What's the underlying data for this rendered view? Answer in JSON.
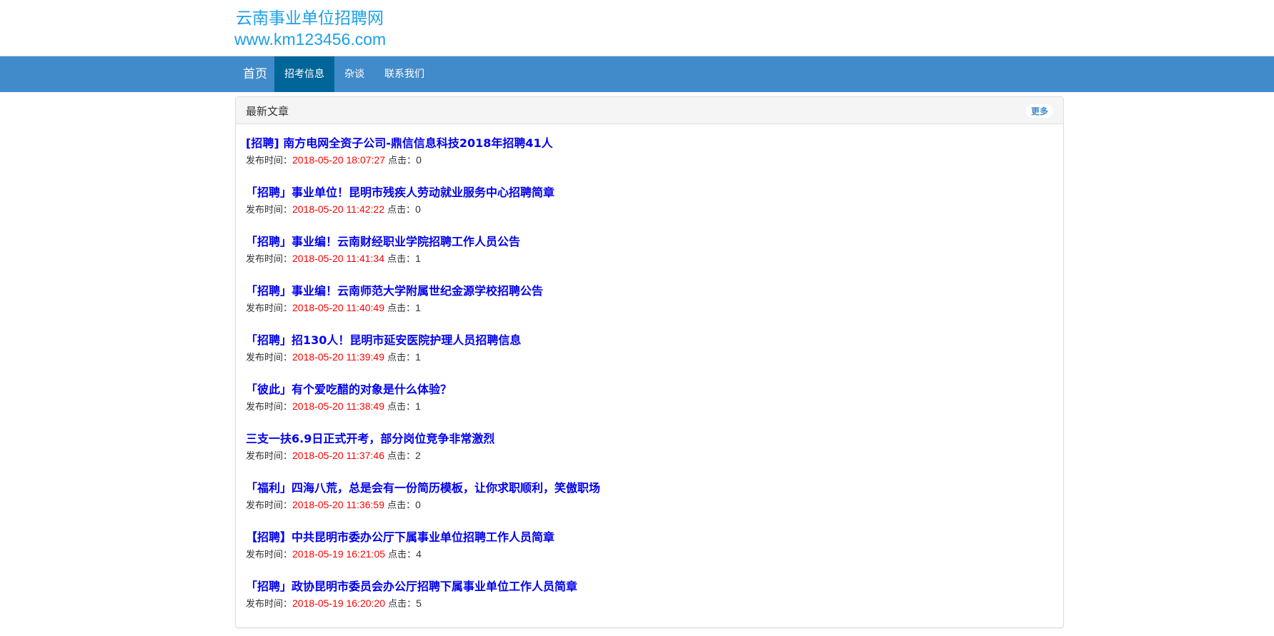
{
  "site": {
    "name": "云南事业单位招聘网",
    "url": "www.km123456.com"
  },
  "nav": [
    {
      "label": "首页",
      "active": false
    },
    {
      "label": "招考信息",
      "active": true
    },
    {
      "label": "杂谈",
      "active": false
    },
    {
      "label": "联系我们",
      "active": false
    }
  ],
  "panel": {
    "title": "最新文章",
    "more": "更多"
  },
  "labels": {
    "published": "发布时间：",
    "clicks": "点击："
  },
  "articles": [
    {
      "title": "[招聘] 南方电网全资子公司-鼎信信息科技2018年招聘41人",
      "time": "2018-05-20 18:07:27",
      "clicks": "0"
    },
    {
      "title": "「招聘」事业单位！昆明市残疾人劳动就业服务中心招聘简章",
      "time": "2018-05-20 11:42:22",
      "clicks": "0"
    },
    {
      "title": "「招聘」事业编！云南财经职业学院招聘工作人员公告",
      "time": "2018-05-20 11:41:34",
      "clicks": "1"
    },
    {
      "title": "「招聘」事业编！云南师范大学附属世纪金源学校招聘公告",
      "time": "2018-05-20 11:40:49",
      "clicks": "1"
    },
    {
      "title": "「招聘」招130人！昆明市延安医院护理人员招聘信息",
      "time": "2018-05-20 11:39:49",
      "clicks": "1"
    },
    {
      "title": "「彼此」有个爱吃醋的对象是什么体验？",
      "time": "2018-05-20 11:38:49",
      "clicks": "1"
    },
    {
      "title": "三支一扶6.9日正式开考，部分岗位竞争非常激烈",
      "time": "2018-05-20 11:37:46",
      "clicks": "2"
    },
    {
      "title": "「福利」四海八荒，总是会有一份简历模板，让你求职顺利，笑傲职场",
      "time": "2018-05-20 11:36:59",
      "clicks": "0"
    },
    {
      "title": "【招聘】中共昆明市委办公厅下属事业单位招聘工作人员简章",
      "time": "2018-05-19 16:21:05",
      "clicks": "4"
    },
    {
      "title": "「招聘」政协昆明市委员会办公厅招聘下属事业单位工作人员简章",
      "time": "2018-05-19 16:20:20",
      "clicks": "5"
    }
  ]
}
